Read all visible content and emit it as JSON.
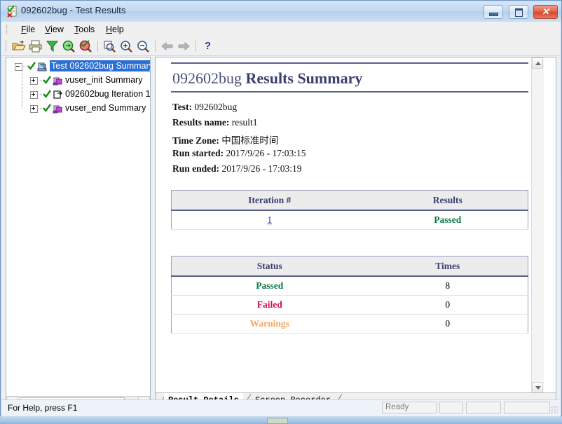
{
  "window": {
    "title": "092602bug - Test Results",
    "icon": "test-results-document-icon",
    "buttons": {
      "minimize": "Minimize",
      "maximize": "Maximize",
      "close": "Close",
      "close_glyph": "✕"
    }
  },
  "menubar": {
    "items": [
      {
        "name": "file",
        "label": "File",
        "accel": "F"
      },
      {
        "name": "view",
        "label": "View",
        "accel": "V"
      },
      {
        "name": "tools",
        "label": "Tools",
        "accel": "T"
      },
      {
        "name": "help",
        "label": "Help",
        "accel": "H"
      }
    ]
  },
  "toolbar": {
    "buttons": [
      {
        "name": "open-icon",
        "title": "Open"
      },
      {
        "name": "print-icon",
        "title": "Print"
      },
      {
        "name": "filter-icon",
        "title": "Filter"
      },
      {
        "name": "find-icon",
        "title": "Find"
      },
      {
        "name": "find-next-icon",
        "title": "Find Next"
      },
      {
        "name": "zoom-fit-icon",
        "title": "Zoom Fit"
      },
      {
        "name": "zoom-in-icon",
        "title": "Zoom In"
      },
      {
        "name": "zoom-out-icon",
        "title": "Zoom Out"
      },
      {
        "name": "back-arrow-icon",
        "title": "Back"
      },
      {
        "name": "forward-arrow-icon",
        "title": "Forward"
      },
      {
        "name": "help-icon",
        "title": "Help",
        "glyph": "?"
      }
    ]
  },
  "tree": {
    "nodes": [
      {
        "label": "Test 092602bug Summary",
        "icon": "test-node-icon",
        "state": "passed",
        "expanded": true,
        "selected": true
      },
      {
        "label": "vuser_init Summary",
        "icon": "vuser-node-icon",
        "state": "passed",
        "expanded": false,
        "selected": false
      },
      {
        "label": "092602bug Iteration 1",
        "icon": "iteration-node-icon",
        "state": "passed",
        "expanded": false,
        "selected": false
      },
      {
        "label": "vuser_end Summary",
        "icon": "vuser-node-icon",
        "state": "passed",
        "expanded": false,
        "selected": false
      }
    ],
    "scrollbar": {
      "left_arrow": "◀",
      "right_arrow": "▶"
    }
  },
  "report": {
    "title_light": "092602bug",
    "title_bold": "Results Summary",
    "details": [
      {
        "key": "Test:",
        "value": "092602bug"
      },
      {
        "key": "Results name:",
        "value": "result1"
      },
      {
        "key": "Time Zone:",
        "value": "中国标准时间"
      },
      {
        "key": "Run started:",
        "value": "2017/9/26 - 17:03:15"
      },
      {
        "key": "Run ended:",
        "value": "2017/9/26 - 17:03:19"
      }
    ],
    "iteration_table": {
      "headers": [
        "Iteration #",
        "Results"
      ],
      "rows": [
        {
          "iteration": "1",
          "result": "Passed",
          "result_state": "passed"
        }
      ]
    },
    "status_table": {
      "headers": [
        "Status",
        "Times"
      ],
      "rows": [
        {
          "status": "Passed",
          "times": "8",
          "state": "passed"
        },
        {
          "status": "Failed",
          "times": "0",
          "state": "failed"
        },
        {
          "status": "Warnings",
          "times": "0",
          "state": "warning"
        }
      ]
    },
    "colors": {
      "passed": "#0a7a4a",
      "failed": "#d1104a",
      "warning": "#f0a868",
      "heading": "#3a3f6e",
      "rule": "#5a5f8c"
    }
  },
  "tabs": [
    {
      "label": "Result Details",
      "active": true
    },
    {
      "label": "Screen Recorder",
      "active": false
    }
  ],
  "statusbar": {
    "hint": "For Help, press F1",
    "panels": [
      "Ready",
      "",
      "",
      ""
    ]
  }
}
